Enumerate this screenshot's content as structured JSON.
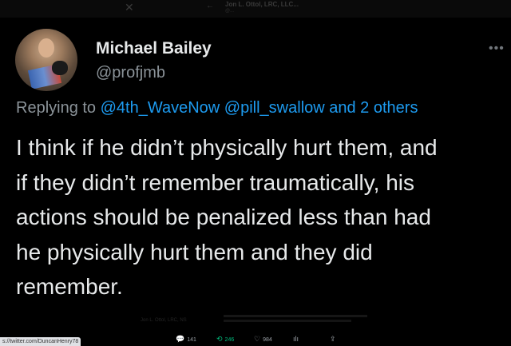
{
  "ghost_header": {
    "close_glyph": "✕",
    "back_glyph": "←",
    "name": "Jon L. Ottol, LRC, LLC...",
    "handle": "@..."
  },
  "tweet": {
    "display_name": "Michael Bailey",
    "handle": "@profjmb",
    "more_glyph": "•••",
    "replying_prefix": "Replying to",
    "replying_to": "@4th_WaveNow @pill_swallow and 2 others",
    "text_lines": [
      "I think if he didn’t physically hurt them, and",
      "if they didn’t remember traumatically, his",
      "actions should be penalized less than had",
      "he physically hurt them and they did",
      "remember."
    ]
  },
  "actions": {
    "reply_icon": "💬",
    "reply_count": "141",
    "retweet_icon": "⟲",
    "retweet_count": "246",
    "like_icon": "♡",
    "like_count": "984",
    "views_icon": "ılı",
    "share_icon": "⇪"
  },
  "ghost_card_name": "Jon L. Ottol, LRC, NS",
  "status_url": "s://twitter.com/DuncanHenry78"
}
